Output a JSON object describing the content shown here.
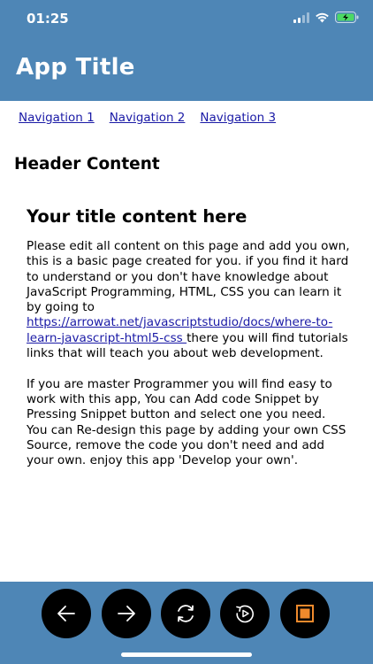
{
  "status_bar": {
    "time": "01:25"
  },
  "header": {
    "title": "App Title"
  },
  "nav": {
    "items": [
      {
        "label": "Navigation 1"
      },
      {
        "label": "Navigation 2"
      },
      {
        "label": "Navigation 3"
      }
    ]
  },
  "main": {
    "header_content": "Header Content",
    "title": "Your title content here",
    "paragraph1_text": "Please edit all content on this page and add you own, this is a basic page created for you. if you find it hard to understand or you don't have knowledge about JavaScript Programming, HTML, CSS you can learn it by going to ",
    "link_text": "https://arrowat.net/javascriptstudio/docs/where-to-learn-javascript-html5-css ",
    "paragraph1_tail": "there you will find tutorials links that will teach you about web development.",
    "paragraph2": "If you are master Programmer you will find easy to work with this app, You can Add code Snippet by Pressing Snippet button and select one you need.",
    "paragraph3": "You can Re-design this page by adding your own CSS Source, remove the code you don't need and add your own. enjoy this app 'Develop your own'."
  },
  "colors": {
    "brand": "#4e86b6",
    "link": "#1a1aa6",
    "stop_accent": "#f08a2c",
    "battery": "#4cd964"
  },
  "toolbar": {
    "buttons": [
      {
        "icon": "arrow-left-icon"
      },
      {
        "icon": "arrow-right-icon"
      },
      {
        "icon": "refresh-icon"
      },
      {
        "icon": "replay-icon"
      },
      {
        "icon": "stop-icon"
      }
    ]
  }
}
